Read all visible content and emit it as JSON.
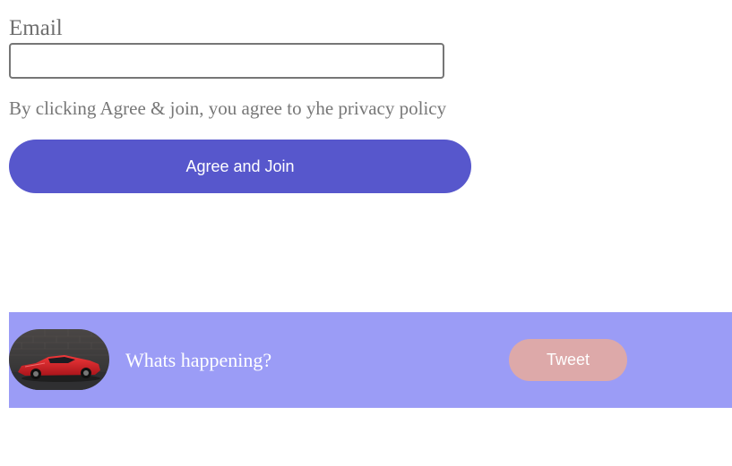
{
  "signup": {
    "email_label": "Email",
    "email_value": "",
    "email_placeholder": "",
    "privacy_text": "By clicking Agree & join, you agree to yhe privacy policy",
    "agree_button_label": "Agree and Join",
    "agree_button_color": "#5757cc"
  },
  "composer": {
    "background_color": "#9b9cf6",
    "avatar_image": "red-sports-car-photo",
    "prompt_text": "Whats happening?",
    "tweet_button_label": "Tweet",
    "tweet_button_color": "#dda9a9"
  }
}
